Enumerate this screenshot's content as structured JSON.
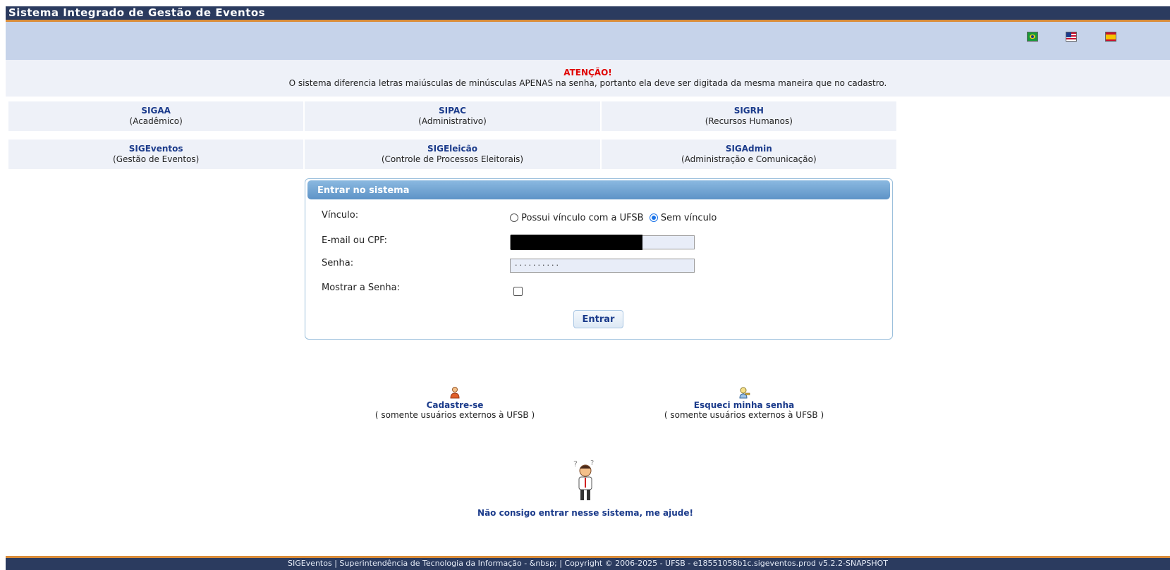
{
  "header": {
    "title": "Sistema Integrado de Gestão de Eventos"
  },
  "languages": [
    {
      "icon": "brazil-flag-icon"
    },
    {
      "icon": "usa-flag-icon"
    },
    {
      "icon": "spain-flag-icon"
    }
  ],
  "notice": {
    "warning": "ATENÇÃO!",
    "message": "O sistema diferencia letras maiúsculas de minúsculas APENAS na senha, portanto ela deve ser digitada da mesma maneira que no cadastro."
  },
  "systems": [
    {
      "name": "SIGAA",
      "desc": "(Acadêmico)"
    },
    {
      "name": "SIPAC",
      "desc": "(Administrativo)"
    },
    {
      "name": "SIGRH",
      "desc": "(Recursos Humanos)"
    },
    {
      "name": "SIGEventos",
      "desc": "(Gestão de Eventos)"
    },
    {
      "name": "SIGEleicão",
      "desc": "(Controle de Processos Eleitorais)"
    },
    {
      "name": "SIGAdmin",
      "desc": "(Administração e Comunicação)"
    }
  ],
  "login": {
    "title": "Entrar no sistema",
    "vinculo_label": "Vínculo:",
    "vinculo_options": [
      "Possui vínculo com a UFSB",
      "Sem vínculo"
    ],
    "vinculo_selected": "Sem vínculo",
    "email_label": "E-mail ou CPF:",
    "senha_label": "Senha:",
    "senha_value": "··········",
    "mostrar_label": "Mostrar a Senha:",
    "mostrar_checked": false,
    "submit": "Entrar"
  },
  "links": {
    "cadastro": {
      "label": "Cadastre-se",
      "note": "( somente usuários externos à UFSB )",
      "icon": "user-add-icon"
    },
    "esqueci": {
      "label": "Esqueci minha senha",
      "note": "( somente usuários externos à UFSB )",
      "icon": "key-user-icon"
    },
    "ajuda": {
      "label": "Não consigo entrar nesse sistema, me ajude!",
      "icon": "confused-man-icon"
    }
  },
  "footer": {
    "text": "SIGEventos | Superintendência de Tecnologia da Informação - &nbsp; | Copyright © 2006-2025 - UFSB - e18551058b1c.sigeventos.prod v5.2.2-SNAPSHOT"
  },
  "colors": {
    "header_bg": "#2b3b5f",
    "accent": "#d98c3a",
    "link": "#1b3b8b",
    "warning": "#e00000"
  }
}
